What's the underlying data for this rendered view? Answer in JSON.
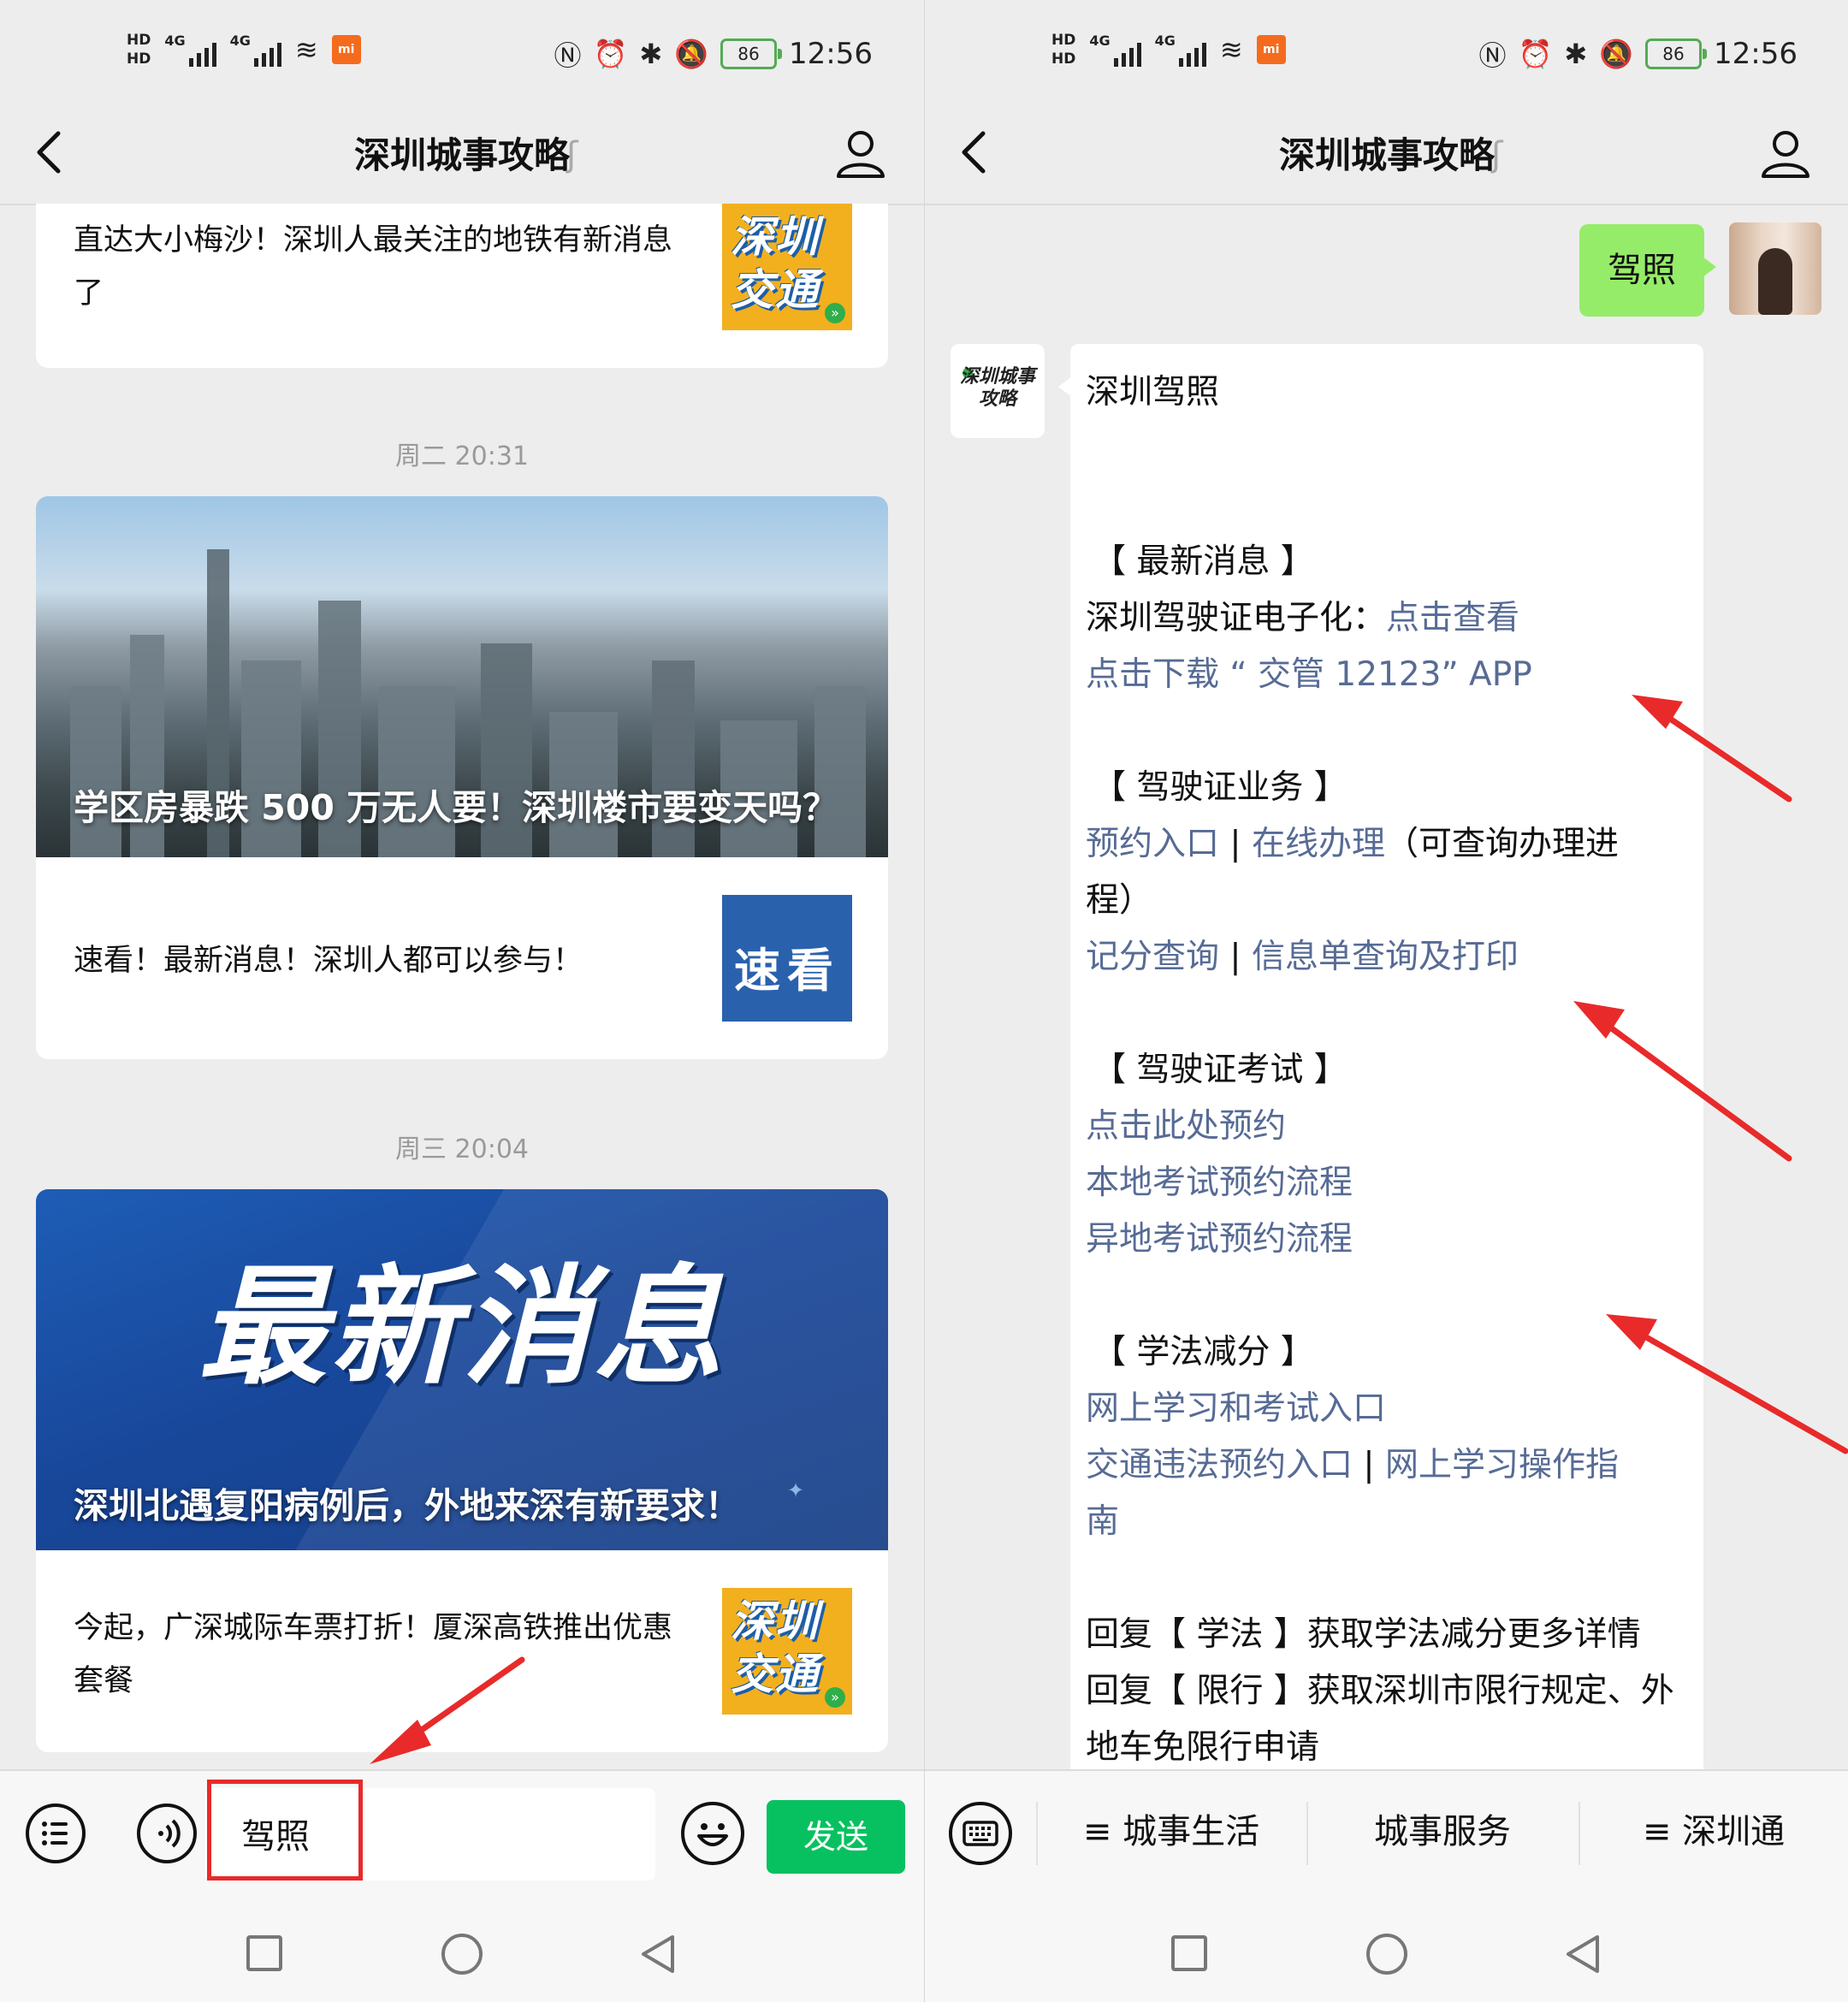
{
  "status_bar": {
    "time": "12:56",
    "battery": "86",
    "hd1": "HD",
    "hd2": "HD",
    "net1": "4G",
    "net2": "4G",
    "mi": "mi"
  },
  "left": {
    "nav": {
      "title": "深圳城事攻略"
    },
    "articles": [
      {
        "text": "直达大小梅沙！深圳人最关注的地铁有新消息了",
        "thumb": "深圳交通"
      },
      {
        "timestamp": "周二 20:31",
        "cover_title": "学区房暴跌 500 万无人要！深圳楼市要变天吗？",
        "text": "速看！最新消息！深圳人都可以参与！",
        "thumb": "速看"
      },
      {
        "timestamp": "周三 20:04",
        "cover_big": "最新消息",
        "cover_title": "深圳北遇复阳病例后，外地来深有新要求！",
        "text": "今起，广深城际车票打折！厦深高铁推出优惠套餐",
        "thumb": "深圳交通"
      }
    ],
    "input": {
      "value": "驾照",
      "send_label": "发送"
    }
  },
  "right": {
    "nav": {
      "title": "深圳城事攻略"
    },
    "my_message": "驾照",
    "bot_logo": "深圳城事攻略",
    "bot_message": {
      "heading": "深圳驾照",
      "sec_news": "【 最新消息 】",
      "news_text": "深圳驾驶证电子化：",
      "news_link": "点击查看",
      "app_link": "点击下载 “ 交管 12123” APP",
      "sec_license": "【 驾驶证业务 】",
      "license_link1": "预约入口",
      "sep": "|",
      "license_link2": "在线办理",
      "license_note_a": "（可查询办理进",
      "license_note_b": "程）",
      "license_link3": "记分查询",
      "license_link4": "信息单查询及打印",
      "sec_exam": "【 驾驶证考试 】",
      "exam_link1": "点击此处预约",
      "exam_link2": "本地考试预约流程",
      "exam_link3": "异地考试预约流程",
      "sec_study": "【 学法减分 】",
      "study_link1": "网上学习和考试入口",
      "study_link2": "交通违法预约入口",
      "study_link3a": "网上学习操作指",
      "study_link3b": "南",
      "reply1": "回复【 学法 】获取学法减分更多详情",
      "reply2a": "回复【 限行 】获取深圳市限行规定、外",
      "reply2b": "地车免限行申请"
    },
    "menu": [
      {
        "label": "≡ 城事生活"
      },
      {
        "label": "城事服务"
      },
      {
        "label": "≡ 深圳通"
      }
    ]
  },
  "colors": {
    "link": "#576b95",
    "send": "#07c160",
    "bubble_me": "#95ec69",
    "annotation": "#e82a2a"
  }
}
